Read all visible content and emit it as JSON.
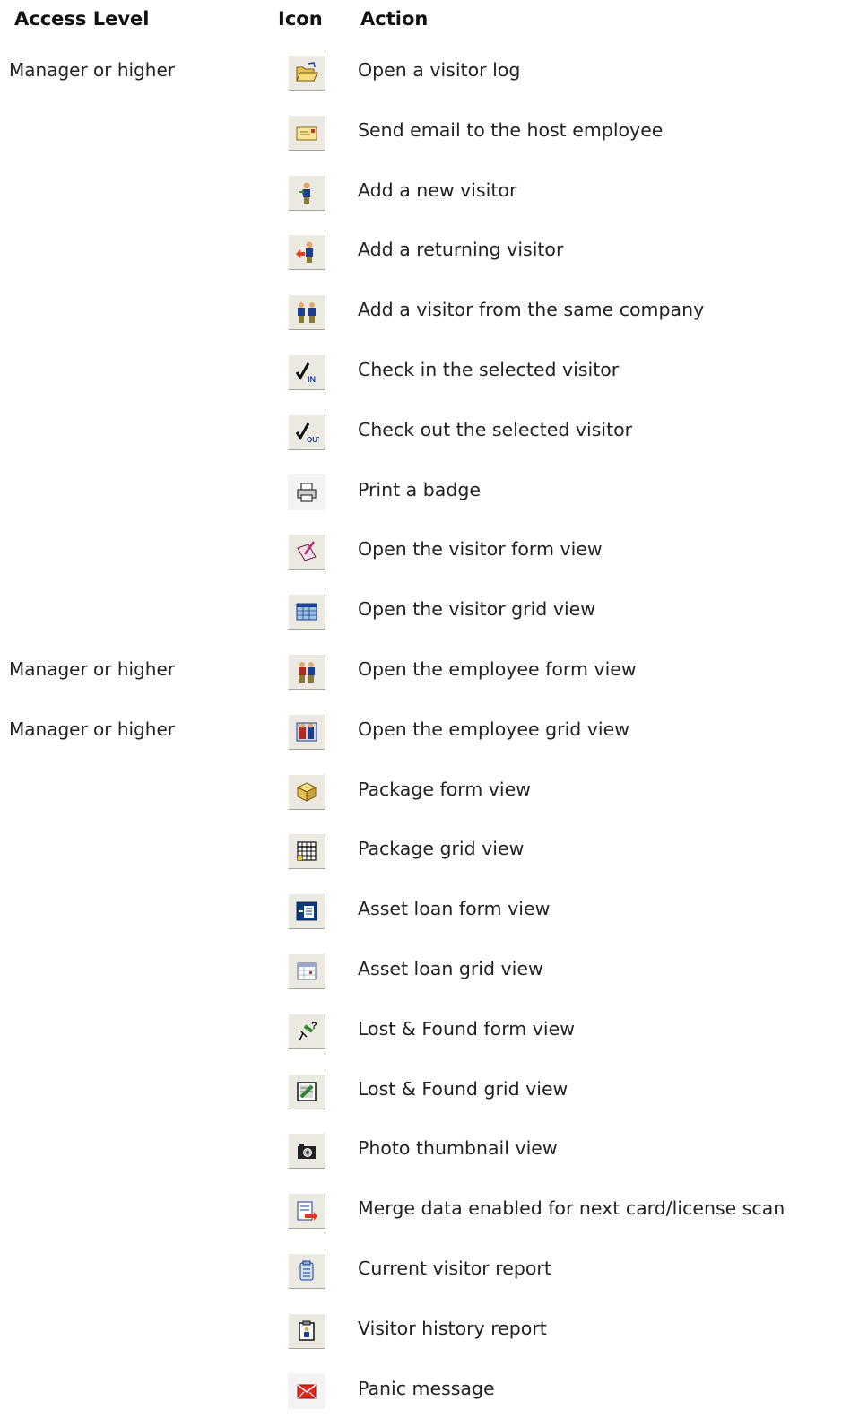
{
  "headers": {
    "access_level": "Access Level",
    "icon": "Icon",
    "action": "Action"
  },
  "rows": [
    {
      "access": "Manager or higher",
      "icon": "open-folder-icon",
      "action": "Open a visitor log"
    },
    {
      "access": "",
      "icon": "email-envelope-icon",
      "action": "Send email to the host employee"
    },
    {
      "access": "",
      "icon": "new-visitor-icon",
      "action": "Add a new visitor"
    },
    {
      "access": "",
      "icon": "returning-visitor-icon",
      "action": "Add a returning visitor"
    },
    {
      "access": "",
      "icon": "same-company-visitor-icon",
      "action": "Add a visitor from the same company"
    },
    {
      "access": "",
      "icon": "check-in-icon",
      "action": "Check in the selected visitor"
    },
    {
      "access": "",
      "icon": "check-out-icon",
      "action": "Check out the selected visitor"
    },
    {
      "access": "",
      "icon": "printer-icon",
      "action": "Print a badge"
    },
    {
      "access": "",
      "icon": "form-edit-icon",
      "action": "Open the visitor form view"
    },
    {
      "access": "",
      "icon": "grid-icon",
      "action": "Open the visitor grid view"
    },
    {
      "access": "Manager or higher",
      "icon": "employee-form-icon",
      "action": "Open the employee form view"
    },
    {
      "access": "Manager or higher",
      "icon": "employee-grid-icon",
      "action": "Open the employee grid view"
    },
    {
      "access": "",
      "icon": "package-icon",
      "action": "Package form view"
    },
    {
      "access": "",
      "icon": "package-grid-icon",
      "action": "Package grid view"
    },
    {
      "access": "",
      "icon": "asset-form-icon",
      "action": "Asset loan form view"
    },
    {
      "access": "",
      "icon": "asset-grid-icon",
      "action": "Asset loan grid view"
    },
    {
      "access": "",
      "icon": "lost-found-form-icon",
      "action": "Lost & Found form view"
    },
    {
      "access": "",
      "icon": "lost-found-grid-icon",
      "action": "Lost & Found grid view"
    },
    {
      "access": "",
      "icon": "camera-icon",
      "action": "Photo thumbnail view"
    },
    {
      "access": "",
      "icon": "merge-data-icon",
      "action": "Merge data enabled for next card/license scan"
    },
    {
      "access": "",
      "icon": "current-report-icon",
      "action": "Current visitor report"
    },
    {
      "access": "",
      "icon": "history-report-icon",
      "action": "Visitor history report"
    },
    {
      "access": "",
      "icon": "panic-envelope-icon",
      "action": "Panic message"
    }
  ]
}
